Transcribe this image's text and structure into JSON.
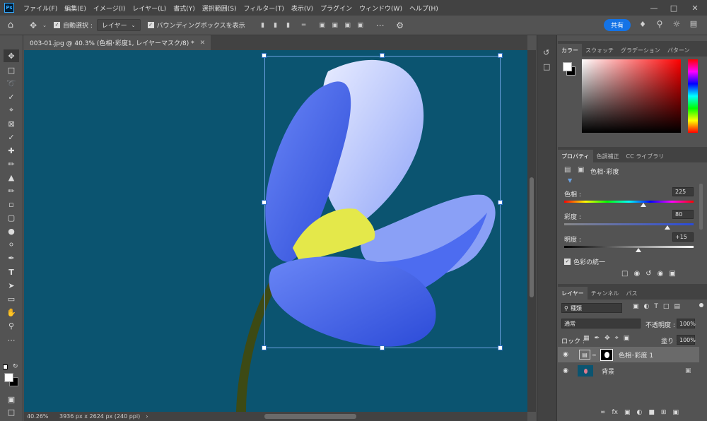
{
  "menu": {
    "logo": "Ps",
    "items": [
      "ファイル(F)",
      "編集(E)",
      "イメージ(I)",
      "レイヤー(L)",
      "書式(Y)",
      "選択範囲(S)",
      "フィルター(T)",
      "表示(V)",
      "プラグイン",
      "ウィンドウ(W)",
      "ヘルプ(H)"
    ]
  },
  "options": {
    "auto_select_label": "自動選択 :",
    "auto_select_target": "レイヤー",
    "bbox_label": "バウンディングボックスを表示",
    "share_label": "共有"
  },
  "document": {
    "tab_title": "003-01.jpg @ 40.3% (色相･彩度1, レイヤーマスク/8) *",
    "zoom": "40.26%",
    "info": "3936 px x 2624 px (240 ppi)"
  },
  "color_panel": {
    "tabs": [
      "カラー",
      "スウォッチ",
      "グラデーション",
      "パターン"
    ]
  },
  "properties_panel": {
    "tabs": [
      "プロパティ",
      "色調補正",
      "CC ライブラリ"
    ],
    "title": "色相･彩度",
    "hue_label": "色相 :",
    "hue_value": "225",
    "hue_fraction": 0.612,
    "saturation_label": "彩度 :",
    "saturation_value": "80",
    "saturation_fraction": 0.8,
    "lightness_label": "明度 :",
    "lightness_value": "+15",
    "lightness_fraction": 0.575,
    "colorize_label": "色彩の統一"
  },
  "layers_panel": {
    "tabs": [
      "レイヤー",
      "チャンネル",
      "パス"
    ],
    "filter_kind": "種類",
    "blend_mode": "通常",
    "opacity_label": "不透明度 :",
    "opacity_value": "100%",
    "lock_label": "ロック :",
    "fill_label": "塗り :",
    "fill_value": "100%",
    "layers": [
      {
        "name": "色相･彩度 1"
      },
      {
        "name": "背景"
      }
    ]
  },
  "colors": {
    "canvas_bg": "#0b5470",
    "accent": "#1473e6",
    "petal": "#4a6cf0",
    "stamen": "#e4e84a"
  }
}
